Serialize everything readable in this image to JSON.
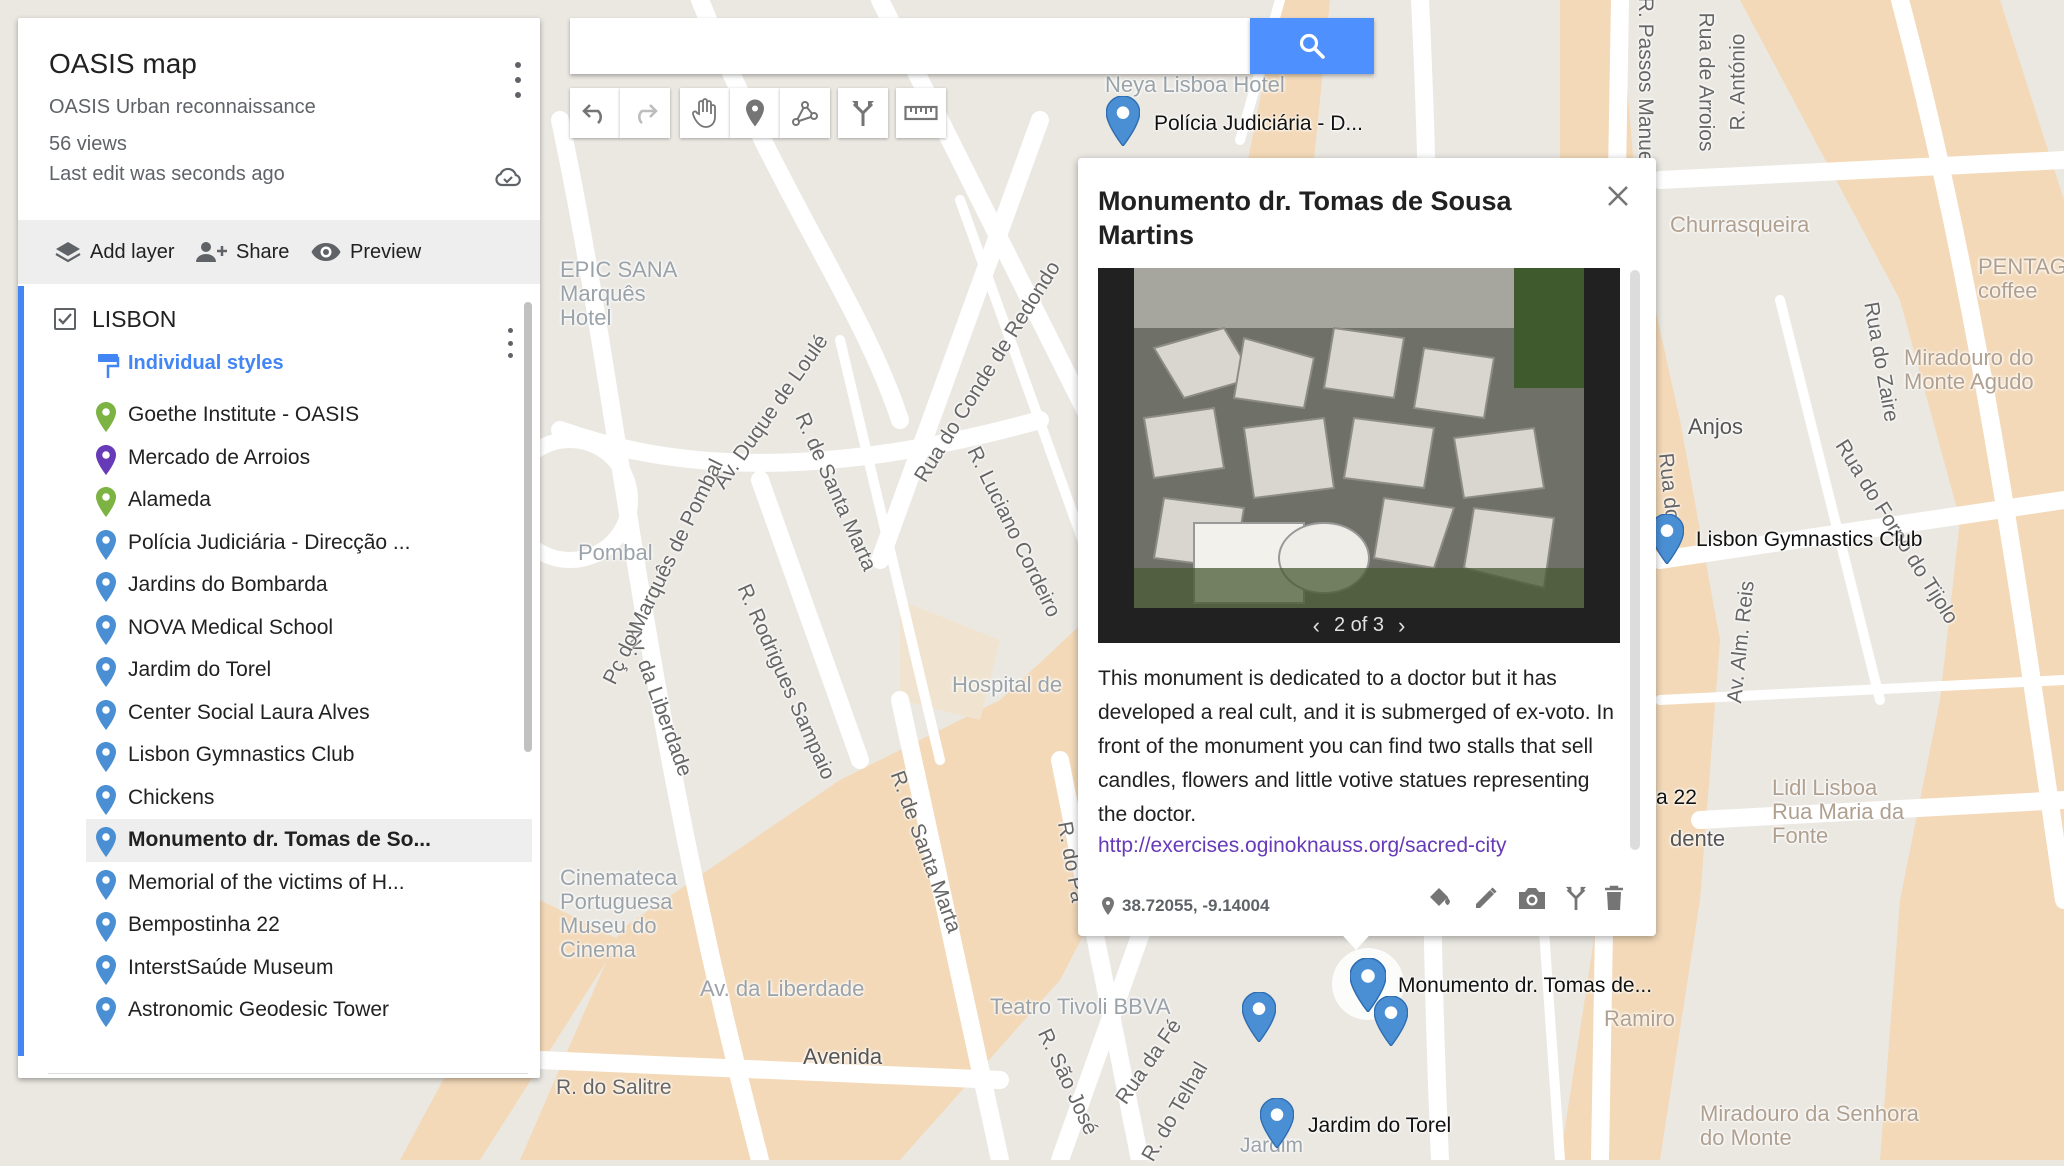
{
  "colors": {
    "accent": "#4285f4",
    "search_button": "#4d90fe",
    "pin_blue": "#4a8fd4",
    "pin_green": "#7cb342",
    "pin_purple": "#673ab7",
    "link": "#673ab7",
    "map_bg": "#ebe8e2",
    "map_road": "#ffffff",
    "map_area": "#f3d9b8"
  },
  "panel": {
    "title": "OASIS map",
    "description": "OASIS Urban reconnaissance",
    "views": "56 views",
    "last_edit": "Last edit was seconds ago",
    "actions": {
      "add_layer": "Add layer",
      "share": "Share",
      "preview": "Preview"
    },
    "layer": {
      "name": "LISBON",
      "checked": true,
      "styles_link": "Individual styles",
      "features": [
        {
          "label": "Goethe Institute - OASIS",
          "color": "green"
        },
        {
          "label": "Mercado de Arroios",
          "color": "purple"
        },
        {
          "label": "Alameda",
          "color": "green"
        },
        {
          "label": "Polícia Judiciária - Direcção ...",
          "color": "blue"
        },
        {
          "label": "Jardins do Bombarda",
          "color": "blue"
        },
        {
          "label": "NOVA Medical School",
          "color": "blue"
        },
        {
          "label": "Jardim do Torel",
          "color": "blue"
        },
        {
          "label": "Center Social Laura Alves",
          "color": "blue"
        },
        {
          "label": "Lisbon Gymnastics Club",
          "color": "blue"
        },
        {
          "label": "Chickens",
          "color": "blue"
        },
        {
          "label": "Monumento dr. Tomas de So...",
          "color": "blue",
          "selected": true
        },
        {
          "label": "Memorial of the victims of H...",
          "color": "blue"
        },
        {
          "label": "Bempostinha 22",
          "color": "blue"
        },
        {
          "label": "InterstSaúde Museum",
          "color": "blue"
        },
        {
          "label": "Astronomic Geodesic Tower",
          "color": "blue"
        }
      ]
    }
  },
  "search": {
    "value": "",
    "placeholder": ""
  },
  "toolbar": {
    "icons": [
      "undo-icon",
      "redo-icon",
      "hand-icon",
      "add-marker-icon",
      "draw-line-icon",
      "directions-icon",
      "ruler-icon"
    ]
  },
  "popup": {
    "title": "Monumento dr. Tomas de Sousa Martins",
    "image_counter": "2 of 3",
    "image_prev": "‹",
    "image_next": "›",
    "description": "This monument is dedicated to a doctor but it has developed a real cult, and it is submerged of ex-voto. In front of the monument you can find two stalls that sell candles, flowers and little votive statues representing the doctor.",
    "link": "http://exercises.oginoknauss.org/sacred-city",
    "coordinates": "38.72055, -9.14004"
  },
  "map": {
    "street_labels": [
      "Av. Duque de Loulé",
      "R. de Santa Marta",
      "Rua do Conde de Redondo",
      "R. Luciano Cordeiro",
      "R. Rodrigues Sampaio",
      "Av. da Liberdade",
      "Pç do Marquês de Pombal",
      "R. de Santa Marta",
      "R. São José",
      "Rua da Fé",
      "R. do Telhal",
      "R. do Salitre",
      "Av. da Liberdade",
      "R. do Pa",
      "R. Passos Manuel",
      "Rua de Arroios",
      "R. António",
      "Av. Alm. Reis",
      "Rua do Zaire",
      "Rua do Forno do Tijolo",
      "Rua dos"
    ],
    "place_labels": [
      "Neya Lisboa Hotel",
      "EPIC SANA Marquês Hotel",
      "Pombal",
      "Hospital de",
      "Cinemateca Portuguesa Museu do Cinema",
      "Teatro Tivoli BBVA",
      "Avenida",
      "Anjos",
      "Churrasqueira",
      "PENTAG coffee",
      "Miradouro do Monte Agudo",
      "Lidl Lisboa Rua Maria da Fonte",
      "Ramiro",
      "Miradouro da Senhora do Monte",
      "dente",
      "a 22",
      "Jardim"
    ],
    "marker_labels": {
      "policia": "Polícia Judiciária - D...",
      "gymnastics": "Lisbon Gymnastics Club",
      "monumento": "Monumento dr. Tomas de...",
      "torel": "Jardim do Torel"
    }
  }
}
